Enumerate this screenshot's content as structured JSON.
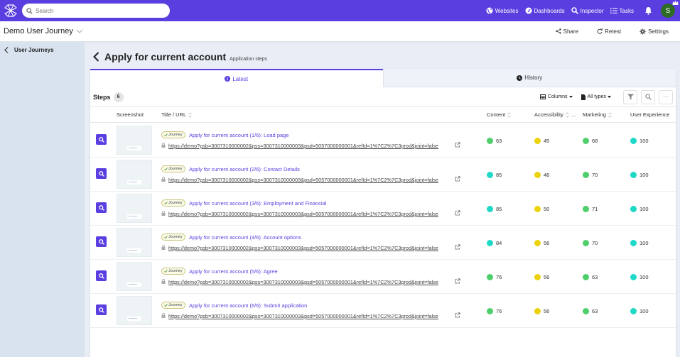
{
  "topbar": {
    "search_placeholder": "Search",
    "nav": [
      {
        "label": "Websites",
        "icon": "globe-icon"
      },
      {
        "label": "Dashboards",
        "icon": "gauge-icon"
      },
      {
        "label": "Inspector",
        "icon": "search-icon"
      },
      {
        "label": "Tasks",
        "icon": "list-icon"
      }
    ],
    "avatar_initial": "S",
    "brand_color": "#5a3ee0"
  },
  "subheader": {
    "journey_name": "Demo User Journey",
    "actions": [
      {
        "label": "Share",
        "icon": "share-icon"
      },
      {
        "label": "Retest",
        "icon": "retest-icon"
      },
      {
        "label": "Settings",
        "icon": "gear-icon"
      }
    ]
  },
  "sidebar": {
    "back_label": "User Journeys"
  },
  "page": {
    "title": "Apply for current account",
    "subtitle": "Application steps"
  },
  "tabs": [
    {
      "label": "Latest",
      "active": true,
      "icon": "info-icon"
    },
    {
      "label": "History",
      "active": false,
      "icon": "clock-icon"
    }
  ],
  "toolbar": {
    "steps_label": "Steps",
    "steps_count": "6",
    "columns_label": "Columns",
    "types_label": "All types",
    "more_label": "···"
  },
  "table": {
    "headers": {
      "screenshot": "Screenshot",
      "title_url": "Title / URL",
      "content": "Content",
      "accessibility": "Accessibility",
      "accessibility_more": "...",
      "marketing": "Marketing",
      "user_experience": "User Experience"
    },
    "badge_label": "Journey",
    "colors": {
      "green": "#4fcf6b",
      "yellow": "#ecd20a",
      "teal": "#1fd9c6"
    },
    "rows": [
      {
        "title": "Apply for current account (1/6): Load page",
        "url": "https://demo?psb=3007310000002&pss=3007310000003&psd=5057000000001&refId=1%7C2%7C3prod&joint=false",
        "content": "63",
        "content_color": "green",
        "accessibility": "45",
        "accessibility_color": "yellow",
        "marketing": "68",
        "marketing_color": "green",
        "ux": "100",
        "ux_color": "teal"
      },
      {
        "title": "Apply for current account (2/6): Contact Details",
        "url": "https://demo?psb=3007310000002&pss=3007310000003&psd=5057000000001&refId=1%7C2%7C3prod&joint=false",
        "content": "85",
        "content_color": "teal",
        "accessibility": "46",
        "accessibility_color": "yellow",
        "marketing": "70",
        "marketing_color": "green",
        "ux": "100",
        "ux_color": "teal"
      },
      {
        "title": "Apply for current account (3/6): Employment and Financial",
        "url": "https://demo?psb=3007310000002&pss=3007310000003&psd=5057000000001&refId=1%7C2%7C3prod&joint=false",
        "content": "85",
        "content_color": "teal",
        "accessibility": "50",
        "accessibility_color": "yellow",
        "marketing": "71",
        "marketing_color": "green",
        "ux": "100",
        "ux_color": "teal"
      },
      {
        "title": "Apply for current account (4/6): Account options",
        "url": "https://demo?psb=3007310000002&pss=3007310000003&psd=5057000000001&refId=1%7C2%7C3prod&joint=false",
        "content": "84",
        "content_color": "teal",
        "accessibility": "56",
        "accessibility_color": "yellow",
        "marketing": "70",
        "marketing_color": "green",
        "ux": "100",
        "ux_color": "teal"
      },
      {
        "title": "Apply for current account (5/6): Agree",
        "url": "https://demo?psb=3007310000002&pss=3007310000003&psd=5057000000001&refId=1%7C2%7C3prod&joint=false",
        "content": "76",
        "content_color": "green",
        "accessibility": "56",
        "accessibility_color": "yellow",
        "marketing": "63",
        "marketing_color": "green",
        "ux": "100",
        "ux_color": "teal"
      },
      {
        "title": "Apply for current account (6/6): Submit application",
        "url": "https://demo?psb=3007310000002&pss=3007310000003&psd=5057000000001&refId=1%7C2%7C3prod&joint=false",
        "content": "76",
        "content_color": "green",
        "accessibility": "56",
        "accessibility_color": "yellow",
        "marketing": "63",
        "marketing_color": "green",
        "ux": "100",
        "ux_color": "teal"
      }
    ]
  }
}
